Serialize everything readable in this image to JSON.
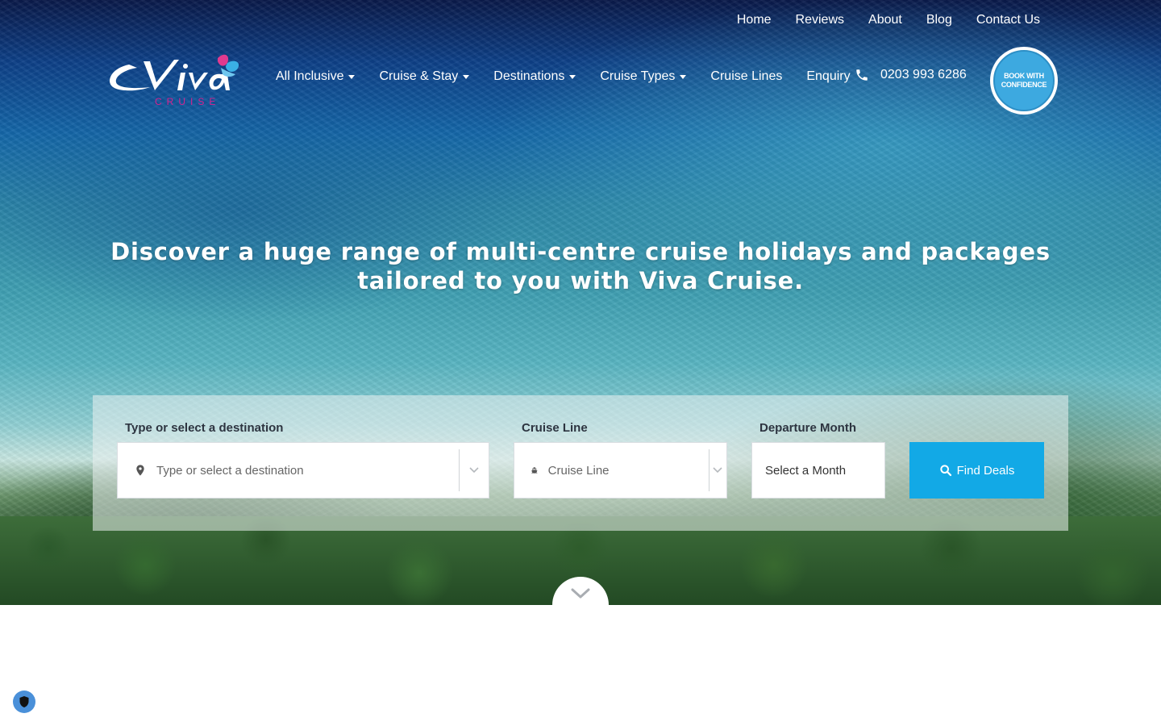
{
  "top_nav": {
    "items": [
      {
        "label": "Home"
      },
      {
        "label": "Reviews"
      },
      {
        "label": "About"
      },
      {
        "label": "Blog"
      },
      {
        "label": "Contact Us"
      }
    ]
  },
  "logo": {
    "wordmark": "Viva",
    "tagline": "CRUISE",
    "colors": {
      "wordmark": "#ffffff",
      "tagline": "#d4238f",
      "butterfly_pink": "#e03a8f",
      "butterfly_blue": "#3ab0e6"
    }
  },
  "main_nav": {
    "items": [
      {
        "label": "All Inclusive",
        "has_dropdown": true
      },
      {
        "label": "Cruise & Stay",
        "has_dropdown": true
      },
      {
        "label": "Destinations",
        "has_dropdown": true
      },
      {
        "label": "Cruise Types",
        "has_dropdown": true
      },
      {
        "label": "Cruise Lines",
        "has_dropdown": false
      },
      {
        "label": "Enquiry",
        "has_dropdown": false
      }
    ],
    "phone": {
      "icon": "phone-icon",
      "number": "0203 993 6286"
    }
  },
  "badge": {
    "line1": "BOOK WITH",
    "line2": "CONFIDENCE",
    "color": "#3da9e0"
  },
  "hero": {
    "headline": "Discover a huge range of multi-centre cruise holidays and packages tailored to you with Viva Cruise."
  },
  "search": {
    "destination": {
      "label": "Type or select a destination",
      "placeholder": "Type or select a destination",
      "icon": "map-pin-icon"
    },
    "cruise_line": {
      "label": "Cruise Line",
      "placeholder": "Cruise Line",
      "icon": "ship-icon"
    },
    "departure": {
      "label": "Departure Month",
      "value": "Select a Month"
    },
    "button": {
      "label": "Find Deals",
      "icon": "search-icon",
      "color": "#12a9e6"
    }
  },
  "scroll": {
    "icon": "chevron-down-icon"
  },
  "privacy": {
    "icon": "shield-icon"
  }
}
